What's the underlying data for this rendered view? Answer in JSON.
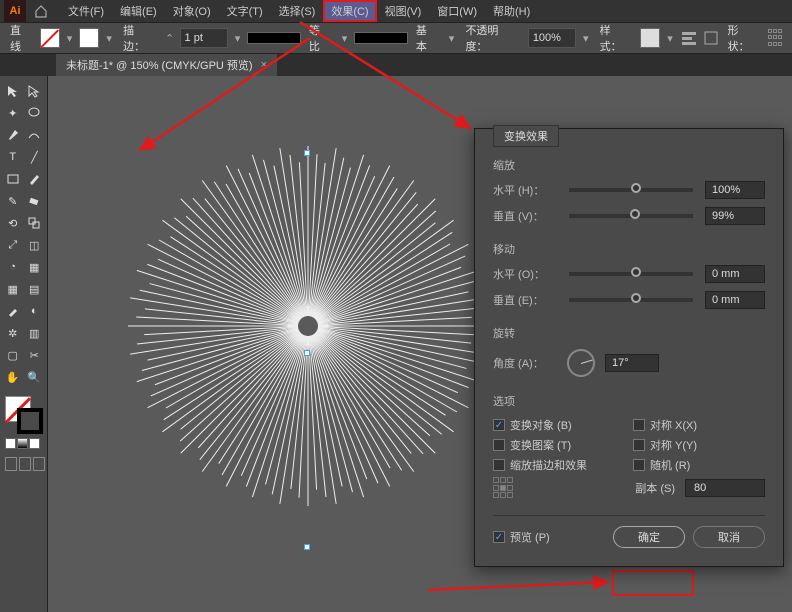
{
  "menubar": {
    "items": [
      {
        "label": "文件(F)"
      },
      {
        "label": "编辑(E)"
      },
      {
        "label": "对象(O)"
      },
      {
        "label": "文字(T)"
      },
      {
        "label": "选择(S)"
      },
      {
        "label": "效果(C)",
        "highlighted": true
      },
      {
        "label": "视图(V)"
      },
      {
        "label": "窗口(W)"
      },
      {
        "label": "帮助(H)"
      }
    ]
  },
  "optionbar": {
    "tool_name": "直线",
    "stroke_label": "描边：",
    "stroke_weight": "1 pt",
    "profile_label": "等比",
    "brush_label": "基本",
    "opacity_label": "不透明度：",
    "opacity_value": "100%",
    "style_label": "样式：",
    "shape_label": "形状："
  },
  "doctab": {
    "title": "未标题-1* @ 150% (CMYK/GPU 预览)"
  },
  "dialog": {
    "title": "变换效果",
    "scale": {
      "title": "缩放",
      "h_label": "水平 (H)：",
      "h_value": "100%",
      "v_label": "垂直 (V)：",
      "v_value": "99%"
    },
    "move": {
      "title": "移动",
      "h_label": "水平 (O)：",
      "h_value": "0 mm",
      "v_label": "垂直 (E)：",
      "v_value": "0 mm"
    },
    "rotate": {
      "title": "旋转",
      "angle_label": "角度 (A)：",
      "angle_value": "17°"
    },
    "options": {
      "title": "选项",
      "transform_obj": "变换对象 (B)",
      "reflect_x": "对称 X(X)",
      "transform_pat": "变换图案 (T)",
      "reflect_y": "对称 Y(Y)",
      "scale_strokes": "缩放描边和效果",
      "random": "随机 (R)"
    },
    "copies": {
      "label": "副本 (S)",
      "value": "80"
    },
    "preview_label": "预览 (P)",
    "ok_label": "确定",
    "cancel_label": "取消"
  }
}
